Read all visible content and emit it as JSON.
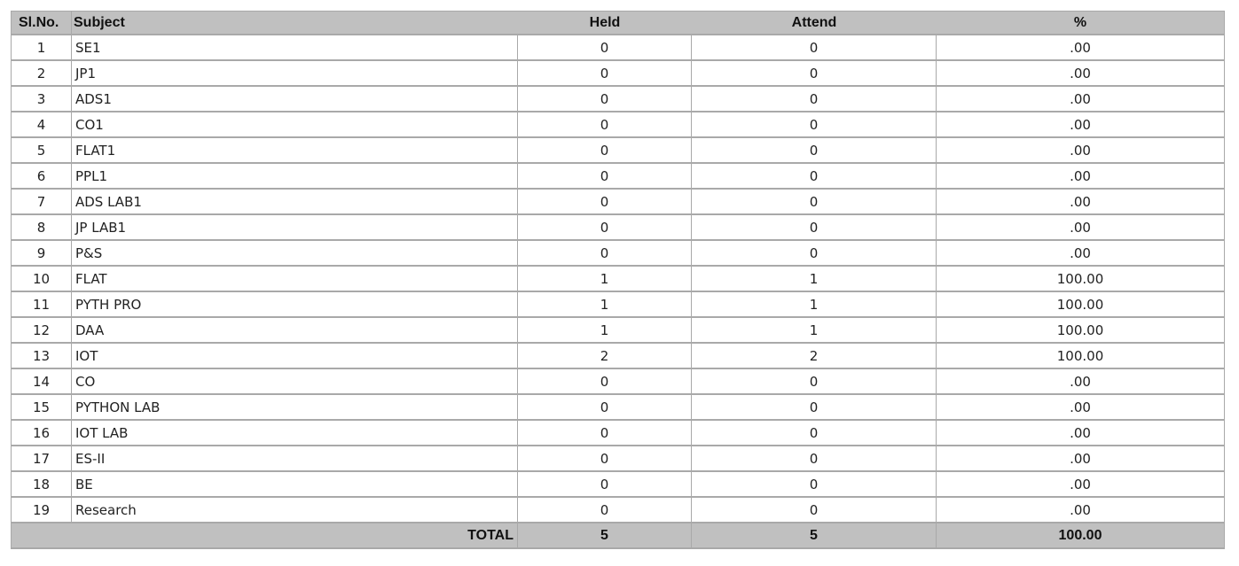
{
  "table": {
    "headers": {
      "slno": "Sl.No.",
      "subject": "Subject",
      "held": "Held",
      "attend": "Attend",
      "percent": "%"
    },
    "rows": [
      {
        "slno": "1",
        "subject": "SE1",
        "held": "0",
        "attend": "0",
        "percent": ".00"
      },
      {
        "slno": "2",
        "subject": "JP1",
        "held": "0",
        "attend": "0",
        "percent": ".00"
      },
      {
        "slno": "3",
        "subject": "ADS1",
        "held": "0",
        "attend": "0",
        "percent": ".00"
      },
      {
        "slno": "4",
        "subject": "CO1",
        "held": "0",
        "attend": "0",
        "percent": ".00"
      },
      {
        "slno": "5",
        "subject": "FLAT1",
        "held": "0",
        "attend": "0",
        "percent": ".00"
      },
      {
        "slno": "6",
        "subject": "PPL1",
        "held": "0",
        "attend": "0",
        "percent": ".00"
      },
      {
        "slno": "7",
        "subject": "ADS LAB1",
        "held": "0",
        "attend": "0",
        "percent": ".00"
      },
      {
        "slno": "8",
        "subject": "JP LAB1",
        "held": "0",
        "attend": "0",
        "percent": ".00"
      },
      {
        "slno": "9",
        "subject": "P&S",
        "held": "0",
        "attend": "0",
        "percent": ".00"
      },
      {
        "slno": "10",
        "subject": "FLAT",
        "held": "1",
        "attend": "1",
        "percent": "100.00"
      },
      {
        "slno": "11",
        "subject": "PYTH PRO",
        "held": "1",
        "attend": "1",
        "percent": "100.00"
      },
      {
        "slno": "12",
        "subject": "DAA",
        "held": "1",
        "attend": "1",
        "percent": "100.00"
      },
      {
        "slno": "13",
        "subject": "IOT",
        "held": "2",
        "attend": "2",
        "percent": "100.00"
      },
      {
        "slno": "14",
        "subject": "CO",
        "held": "0",
        "attend": "0",
        "percent": ".00"
      },
      {
        "slno": "15",
        "subject": "PYTHON LAB",
        "held": "0",
        "attend": "0",
        "percent": ".00"
      },
      {
        "slno": "16",
        "subject": "IOT LAB",
        "held": "0",
        "attend": "0",
        "percent": ".00"
      },
      {
        "slno": "17",
        "subject": "ES-II",
        "held": "0",
        "attend": "0",
        "percent": ".00"
      },
      {
        "slno": "18",
        "subject": "BE",
        "held": "0",
        "attend": "0",
        "percent": ".00"
      },
      {
        "slno": "19",
        "subject": "Research",
        "held": "0",
        "attend": "0",
        "percent": ".00"
      }
    ],
    "total": {
      "label": "TOTAL",
      "held": "5",
      "attend": "5",
      "percent": "100.00"
    }
  },
  "colors": {
    "header_bg": "#c0c0c0",
    "border": "#a9a9a9",
    "row_bg": "#ffffff"
  }
}
